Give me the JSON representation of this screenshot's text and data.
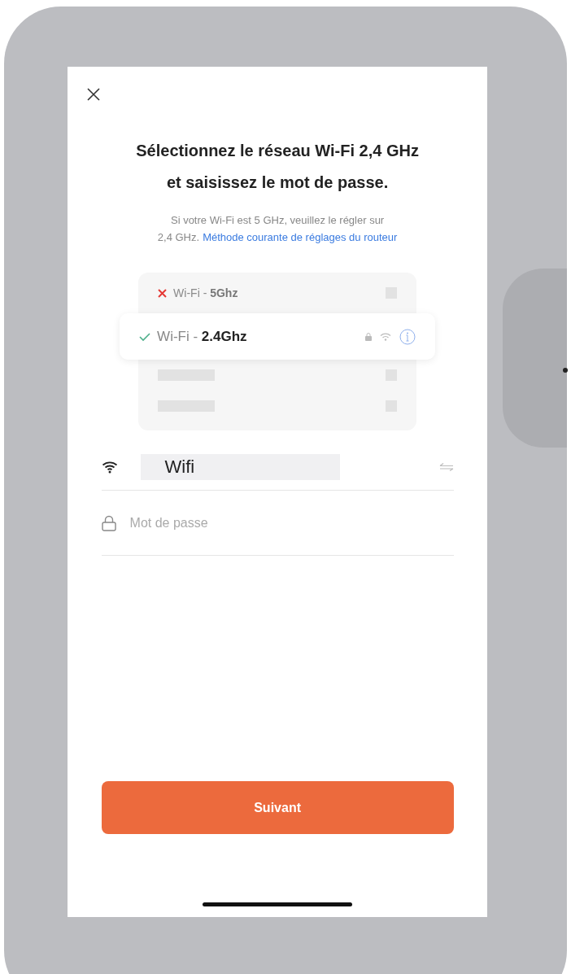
{
  "title_lines": [
    "Sélectionnez le réseau Wi-Fi 2,4 GHz",
    "et saisissez le mot de passe."
  ],
  "hint": {
    "lines": [
      "Si votre Wi-Fi est 5 GHz, veuillez le régler sur",
      "2,4 GHz."
    ],
    "link": "Méthode courante de réglages du routeur"
  },
  "networks": [
    {
      "label": "Wi-Fi - **5Ghz**",
      "selected": false
    },
    {
      "label": "Wi-Fi - **2.4Ghz**",
      "selected": true
    }
  ],
  "wifi_field": {
    "value": "Wifi"
  },
  "password_field": {
    "placeholder": "Mot de passe"
  },
  "next_button": "Suivant"
}
